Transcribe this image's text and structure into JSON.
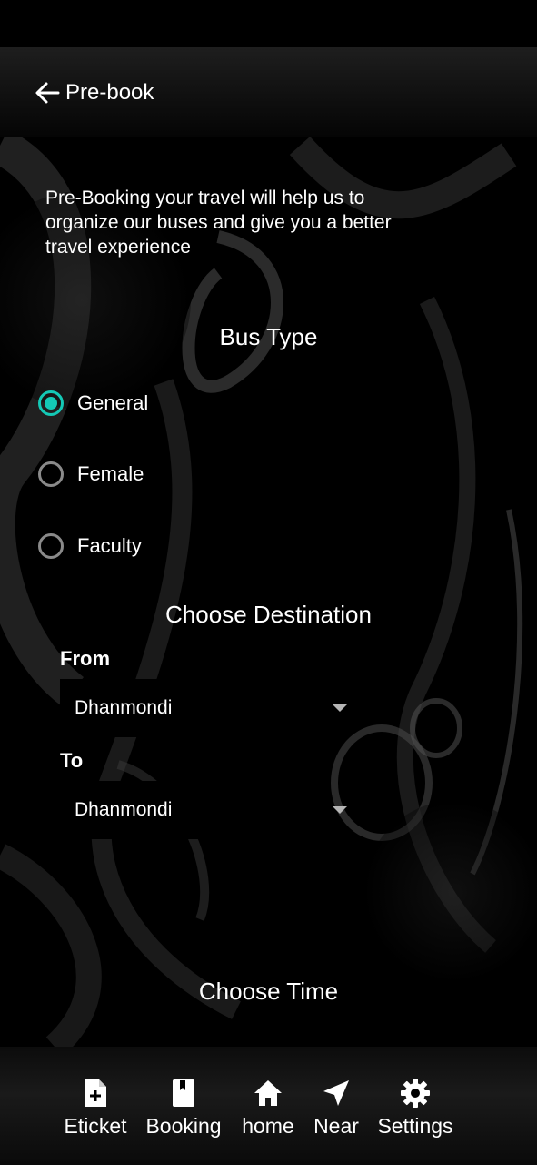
{
  "app_bar": {
    "title": "Pre-book",
    "back_icon": "arrow-left-icon"
  },
  "intro": {
    "text": "Pre-Booking your travel will help us to organize our buses and give you a better travel experience"
  },
  "bus_type": {
    "title": "Bus Type",
    "selected": "General",
    "accent_color": "#14c9b6",
    "options": [
      {
        "label": "General",
        "checked": true
      },
      {
        "label": "Female",
        "checked": false
      },
      {
        "label": "Faculty",
        "checked": false
      }
    ]
  },
  "destination": {
    "title": "Choose Destination",
    "from_label": "From",
    "from_value": "Dhanmondi",
    "to_label": "To",
    "to_value": "Dhanmondi"
  },
  "time": {
    "title": "Choose Time"
  },
  "bottom_nav": {
    "items": [
      {
        "label": "Eticket",
        "icon": "ticket-add-icon"
      },
      {
        "label": "Booking",
        "icon": "book-icon"
      },
      {
        "label": "home",
        "icon": "home-icon"
      },
      {
        "label": "Near",
        "icon": "navigation-icon"
      },
      {
        "label": "Settings",
        "icon": "gear-icon"
      }
    ]
  }
}
